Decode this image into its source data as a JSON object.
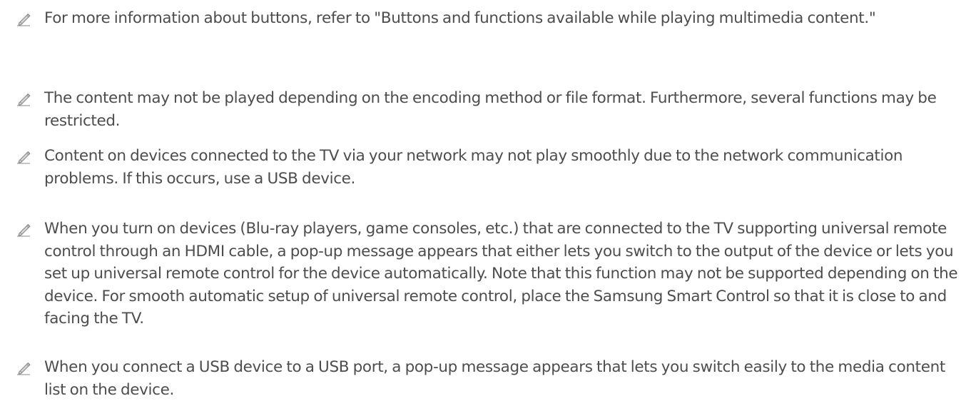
{
  "notes": [
    {
      "icon": "pencil-note-icon",
      "text": "For more information about buttons, refer to \"Buttons and functions available while playing multimedia content.\""
    },
    {
      "icon": "pencil-note-icon",
      "text": "The content may not be played depending on the encoding method or file format. Furthermore, several functions may be restricted."
    },
    {
      "icon": "pencil-note-icon",
      "text": "Content on devices connected to the TV via your network may not play smoothly due to the network communication problems. If this occurs, use a USB device."
    },
    {
      "icon": "pencil-note-icon",
      "text": "When you turn on devices (Blu-ray players, game consoles, etc.) that are connected to the TV supporting universal remote control through an HDMI cable, a pop-up message appears that either lets you switch to the output of the device or lets you set up universal remote control for the device automatically. Note that this function may not be supported depending on the device. For smooth automatic setup of universal remote control, place the Samsung Smart Control so that it is close to and facing the TV."
    },
    {
      "icon": "pencil-note-icon",
      "text": "When you connect a USB device to a USB port, a pop-up message appears that lets you switch easily to the media content list on the device."
    }
  ],
  "colors": {
    "text": "#4d4d4d",
    "icon": "#8a8a8a"
  }
}
